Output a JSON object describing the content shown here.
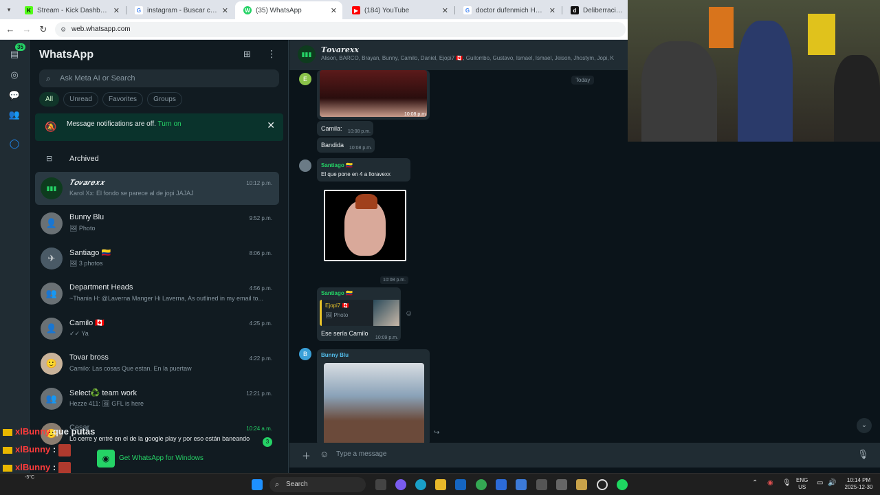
{
  "browser": {
    "tabs": [
      {
        "title": "Stream - Kick Dashboard",
        "icon": "K",
        "color": "#53fc18"
      },
      {
        "title": "instagram - Buscar con Google",
        "icon": "G",
        "color": "#4285f4"
      },
      {
        "title": "(35) WhatsApp",
        "icon": "W",
        "color": "#25d366"
      },
      {
        "title": "(184) YouTube",
        "icon": "▶",
        "color": "#ff0000"
      },
      {
        "title": "doctor dufenmich HERMA O - ",
        "icon": "G",
        "color": "#4285f4"
      },
      {
        "title": "Deliberración",
        "icon": "d",
        "color": "#111111"
      }
    ],
    "url": "web.whatsapp.com"
  },
  "rail": {
    "unread_badge": "35"
  },
  "sidebar": {
    "title": "WhatsApp",
    "search_placeholder": "Ask Meta AI or Search",
    "filters": [
      "All",
      "Unread",
      "Favorites",
      "Groups"
    ],
    "notification": {
      "text": "Message notifications are off.",
      "action": "Turn on"
    },
    "archived_label": "Archived",
    "chats": [
      {
        "name": "𝑻𝒐𝒗𝒂𝒓𝒆𝒙𝒙",
        "preview": "Karol Xx: El fondo se parece al de jopi JAJAJ",
        "time": "10:12 p.m.",
        "selected": true
      },
      {
        "name": "Bunny Blu",
        "preview": "🖼 Photo",
        "time": "9:52 p.m."
      },
      {
        "name": "Santiago 🇨🇴",
        "preview": "🖼 3 photos",
        "time": "8:06 p.m."
      },
      {
        "name": "Department Heads",
        "preview": "~Thania H: @Laverna Manger  Hi Laverna, As outlined in my email to...",
        "time": "4:56 p.m."
      },
      {
        "name": "Camilo 🇨🇦",
        "preview": "✓✓ Ya",
        "time": "4:25 p.m."
      },
      {
        "name": "Tovar bross",
        "preview": "Camilo: Las cosas Que estan. En la puertaw",
        "time": "4:22 p.m."
      },
      {
        "name": "Select♻️ team work",
        "preview": "Hezze 411: 🖼 GFL is here",
        "time": "12:21 p.m."
      },
      {
        "name": "Cesar",
        "preview": "Lo cerre y entré en el de la google play y por eso están baneando",
        "time": "10:24 a.m.",
        "unread": "3"
      }
    ],
    "get_windows": "Get WhatsApp for Windows"
  },
  "conversation": {
    "group_name": "𝑻𝒐𝒗𝒂𝒓𝒆𝒙𝒙",
    "members": "Alison, BARCO, Brayan, Bunny, Camilo, Daniel, Ejopi7 🇨🇦, Guilombo, Gustavo, Ismael, Ismael, Jeison, Jhostym, Jopi, K",
    "date_chip": "Today",
    "messages": [
      {
        "type": "image",
        "time": "10:08 p.m."
      },
      {
        "text": "Camila:",
        "time": "10:08 p.m."
      },
      {
        "text": "Bandida",
        "time": "10:08 p.m."
      },
      {
        "sender": "Santiago 🇨🇴",
        "reply": "El que pone en 4 a lloravexx"
      },
      {
        "type": "sticker",
        "time": "10:08 p.m."
      },
      {
        "sender": "Santiago 🇨🇴",
        "quoted_sender": "Ejopi7 🇨🇦",
        "quoted_text": "🖼 Photo",
        "text": "Ese sería Camilo",
        "time": "10:09 p.m."
      },
      {
        "sender": "Bunny Blu",
        "type": "image"
      }
    ],
    "composer_placeholder": "Type a message"
  },
  "stream_chat": [
    {
      "user": "xlBunny",
      "text": "que putas"
    },
    {
      "user": "xlBunny",
      "text": ":"
    },
    {
      "user": "xlBunny",
      "text": ":"
    },
    {
      "user": "xlBunny",
      "text": ":"
    }
  ],
  "taskbar": {
    "search_label": "Search",
    "weather": "-5°C",
    "lang_top": "ENG",
    "lang_bottom": "US",
    "time": "10:14 PM",
    "date": "2025-12-30"
  }
}
